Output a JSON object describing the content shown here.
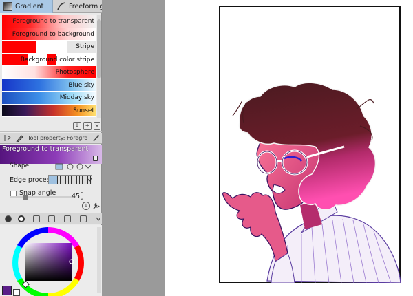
{
  "tabs": [
    {
      "label": "Gradient",
      "icon": "gradient-icon",
      "active": true
    },
    {
      "label": "Freeform gr",
      "icon": "freeform-gradient-icon",
      "active": false
    }
  ],
  "gradients": [
    {
      "label": "Foreground to transparent",
      "selected": true
    },
    {
      "label": "Foreground to background",
      "selected": false
    },
    {
      "label": "Stripe",
      "selected": false
    },
    {
      "label": "Background color stripe",
      "selected": false
    },
    {
      "label": "Photosphere",
      "selected": false
    },
    {
      "label": "Blue sky",
      "selected": false
    },
    {
      "label": "Midday sky",
      "selected": false
    },
    {
      "label": "Sunset",
      "selected": false
    }
  ],
  "gradient_tools": [
    "import-icon",
    "duplicate-icon",
    "delete-icon"
  ],
  "tool_property": {
    "title": "Tool property: Foreground",
    "selected_gradient": "Foreground to transparent",
    "shape_label": "Shape",
    "edge_label": "Edge process",
    "snap_label": "Snap angle",
    "snap_value": "45"
  },
  "colors": {
    "accent": "#a9c8e6",
    "foreground": "#5a1d88",
    "background": "#ffffff",
    "canvas_bg": "#9a9a9a"
  }
}
